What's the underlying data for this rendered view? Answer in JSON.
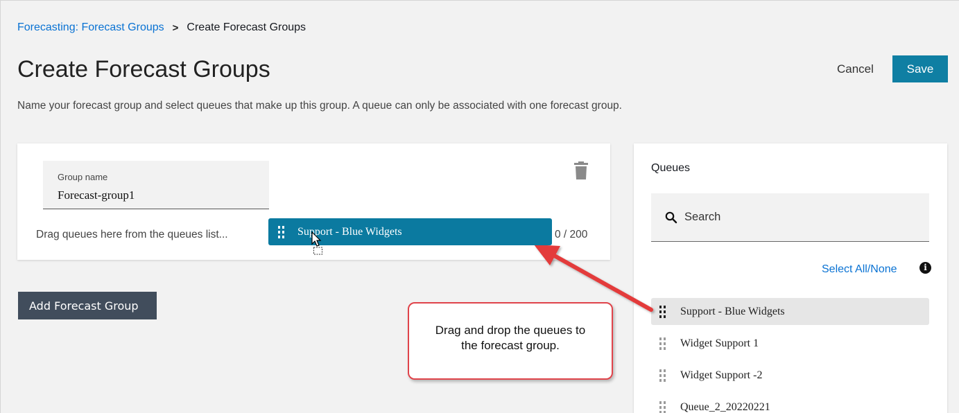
{
  "breadcrumb": {
    "parent": "Forecasting: Forecast Groups",
    "separator": ">",
    "current": "Create Forecast Groups"
  },
  "header": {
    "title": "Create Forecast Groups",
    "cancel_label": "Cancel",
    "save_label": "Save"
  },
  "description": "Name your forecast group and select queues that make up this group. A queue can only be associated with one forecast group.",
  "group_card": {
    "name_label": "Group name",
    "name_value": "Forecast-group1",
    "drop_hint": "Drag queues here from the queues list...",
    "counter": "0 / 200",
    "dragged_item": "Support - Blue Widgets"
  },
  "add_group_label": "Add Forecast Group",
  "callout": {
    "line1": "Drag and drop the queues to",
    "line2": "the forecast group."
  },
  "queues_panel": {
    "title": "Queues",
    "search_placeholder": "Search",
    "select_all_label": "Select All/None",
    "info_icon": "i",
    "items": [
      {
        "label": "Support - Blue Widgets"
      },
      {
        "label": "Widget Support 1"
      },
      {
        "label": "Widget Support -2"
      },
      {
        "label": "Queue_2_20220221"
      }
    ]
  },
  "colors": {
    "primary": "#0f7fa3",
    "link": "#0972d3",
    "callout_border": "#e0434a",
    "arrow": "#e33b3b",
    "dark_button": "#414d5c"
  }
}
